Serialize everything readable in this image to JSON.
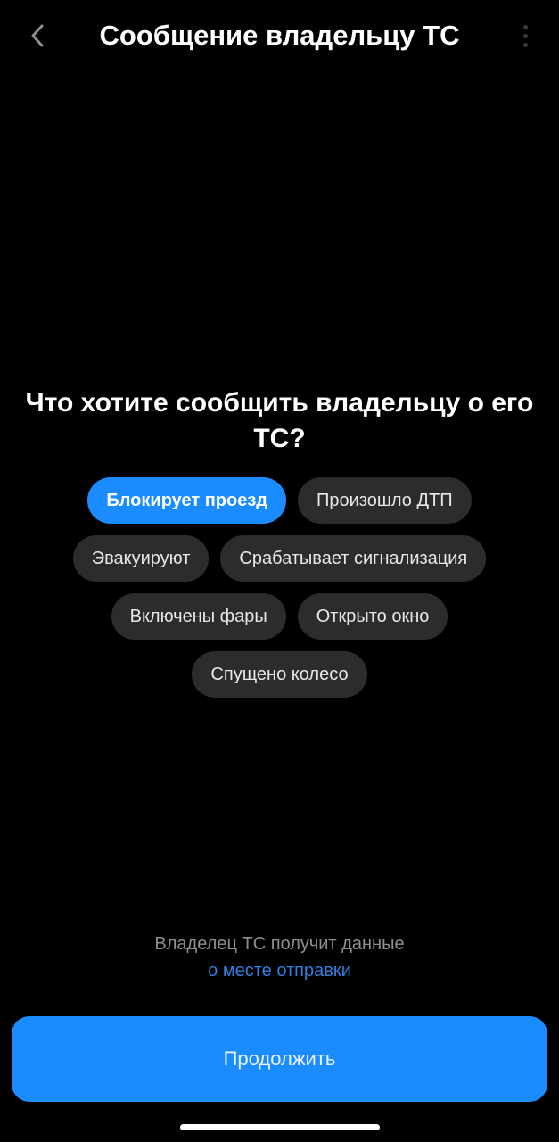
{
  "header": {
    "title": "Сообщение владельцу ТС",
    "back_icon": "chevron-left-icon",
    "more_icon": "more-vertical-icon"
  },
  "question": "Что хотите сообщить владельцу о его ТС?",
  "chips": {
    "rows": [
      [
        {
          "label": "Блокирует проезд",
          "selected": true
        },
        {
          "label": "Произошло ДТП",
          "selected": false
        }
      ],
      [
        {
          "label": "Эвакуируют",
          "selected": false
        },
        {
          "label": "Срабатывает сигнализация",
          "selected": false
        }
      ],
      [
        {
          "label": "Включены фары",
          "selected": false
        },
        {
          "label": "Открыто окно",
          "selected": false
        }
      ],
      [
        {
          "label": "Спущено колесо",
          "selected": false
        }
      ]
    ]
  },
  "footnote": {
    "text": "Владелец ТС получит данные",
    "link": "о месте отправки"
  },
  "continue_label": "Продолжить",
  "colors": {
    "background": "#000000",
    "accent": "#1a8cff",
    "chip": "#2c2c2e",
    "muted_text": "#8e8e93",
    "link": "#2f7fe0"
  }
}
